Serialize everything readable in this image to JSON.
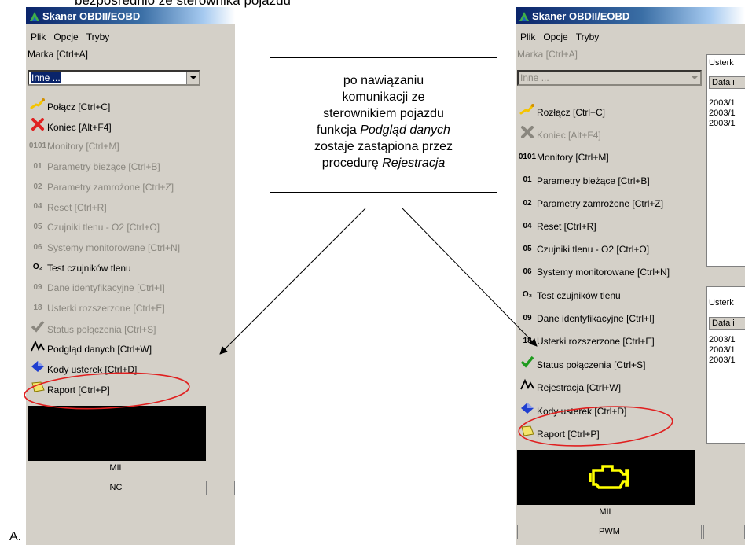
{
  "heading": "bezpośrednio ze sterownika pojazdu",
  "letter": "A.",
  "callout": {
    "l1": "po nawiązaniu",
    "l2": "komunikacji ze",
    "l3": "sterownikiem pojazdu",
    "l4a": "funkcja ",
    "l4b": "Podgląd danych",
    "l5": "zostaje zastąpiona przez",
    "l6a": "procedurę ",
    "l6b": "Rejestracja"
  },
  "left": {
    "title": "Skaner OBDII/EOBD",
    "menu": [
      "Plik",
      "Opcje",
      "Tryby"
    ],
    "marka": "Marka [Ctrl+A]",
    "combo": "Inne ...",
    "items": [
      {
        "icon": "connect-icon",
        "glyph": "",
        "label": "Połącz [Ctrl+C]",
        "enabled": true
      },
      {
        "icon": "close-icon",
        "glyph": "",
        "label": "Koniec [Alt+F4]",
        "enabled": true
      },
      {
        "icon": "monitors-icon",
        "glyph": "0101",
        "label": "Monitory [Ctrl+M]",
        "enabled": false
      },
      {
        "icon": "num-01-icon",
        "glyph": "01",
        "label": "Parametry bieżące [Ctrl+B]",
        "enabled": false
      },
      {
        "icon": "num-02-icon",
        "glyph": "02",
        "label": "Parametry zamrożone [Ctrl+Z]",
        "enabled": false
      },
      {
        "icon": "num-04-icon",
        "glyph": "04",
        "label": "Reset [Ctrl+R]",
        "enabled": false
      },
      {
        "icon": "num-05-icon",
        "glyph": "05",
        "label": "Czujniki tlenu - O2 [Ctrl+O]",
        "enabled": false
      },
      {
        "icon": "num-06-icon",
        "glyph": "06",
        "label": "Systemy monitorowane [Ctrl+N]",
        "enabled": false
      },
      {
        "icon": "o2-icon",
        "glyph": "O₂",
        "label": "Test czujników tlenu",
        "enabled": true
      },
      {
        "icon": "num-09-icon",
        "glyph": "09",
        "label": "Dane identyfikacyjne [Ctrl+I]",
        "enabled": false
      },
      {
        "icon": "num-18-icon",
        "glyph": "18",
        "label": "Usterki rozszerzone [Ctrl+E]",
        "enabled": false
      },
      {
        "icon": "checkmark-icon",
        "glyph": "",
        "label": "Status połączenia [Ctrl+S]",
        "enabled": false
      },
      {
        "icon": "waveform-icon",
        "glyph": "",
        "label": "Podgląd danych [Ctrl+W]",
        "enabled": true
      },
      {
        "icon": "diamond-icon",
        "glyph": "",
        "label": "Kody usterek [Ctrl+D]",
        "enabled": true
      },
      {
        "icon": "report-icon",
        "glyph": "",
        "label": "Raport [Ctrl+P]",
        "enabled": true
      }
    ],
    "mil": "MIL",
    "status": "NC"
  },
  "right": {
    "title": "Skaner OBDII/EOBD",
    "menu": [
      "Plik",
      "Opcje",
      "Tryby"
    ],
    "marka": "Marka [Ctrl+A]",
    "combo": "Inne ...",
    "items": [
      {
        "icon": "connect-icon",
        "glyph": "",
        "label": "Rozłącz [Ctrl+C]",
        "enabled": true
      },
      {
        "icon": "close-icon",
        "glyph": "",
        "label": "Koniec [Alt+F4]",
        "enabled": false
      },
      {
        "icon": "monitors-icon",
        "glyph": "0101",
        "label": "Monitory [Ctrl+M]",
        "enabled": true
      },
      {
        "icon": "num-01-icon",
        "glyph": "01",
        "label": "Parametry bieżące [Ctrl+B]",
        "enabled": true
      },
      {
        "icon": "num-02-icon",
        "glyph": "02",
        "label": "Parametry zamrożone [Ctrl+Z]",
        "enabled": true
      },
      {
        "icon": "num-04-icon",
        "glyph": "04",
        "label": "Reset [Ctrl+R]",
        "enabled": true
      },
      {
        "icon": "num-05-icon",
        "glyph": "05",
        "label": "Czujniki tlenu - O2 [Ctrl+O]",
        "enabled": true
      },
      {
        "icon": "num-06-icon",
        "glyph": "06",
        "label": "Systemy monitorowane [Ctrl+N]",
        "enabled": true
      },
      {
        "icon": "o2-icon",
        "glyph": "O₂",
        "label": "Test czujników tlenu",
        "enabled": true
      },
      {
        "icon": "num-09-icon",
        "glyph": "09",
        "label": "Dane identyfikacyjne [Ctrl+I]",
        "enabled": true
      },
      {
        "icon": "num-18-icon",
        "glyph": "18",
        "label": "Usterki rozszerzone [Ctrl+E]",
        "enabled": true
      },
      {
        "icon": "checkmark-icon",
        "glyph": "",
        "label": "Status połączenia [Ctrl+S]",
        "enabled": true
      },
      {
        "icon": "waveform-icon",
        "glyph": "",
        "label": "Rejestracja [Ctrl+W]",
        "enabled": true
      },
      {
        "icon": "diamond-icon",
        "glyph": "",
        "label": "Kody usterek [Ctrl+D]",
        "enabled": true
      },
      {
        "icon": "report-icon",
        "glyph": "",
        "label": "Raport [Ctrl+P]",
        "enabled": true
      }
    ],
    "mil": "MIL",
    "status": "PWM",
    "panel1": {
      "header": "Usterk",
      "col": "Data i",
      "rows": [
        "2003/1",
        "2003/1",
        "2003/1"
      ]
    },
    "panel2": {
      "header": "Usterk",
      "col": "Data i",
      "rows": [
        "2003/1",
        "2003/1",
        "2003/1"
      ]
    }
  },
  "colors": {
    "annotation": "#e02020",
    "engine": "#ffff00",
    "titlebar": "#0a246a"
  }
}
